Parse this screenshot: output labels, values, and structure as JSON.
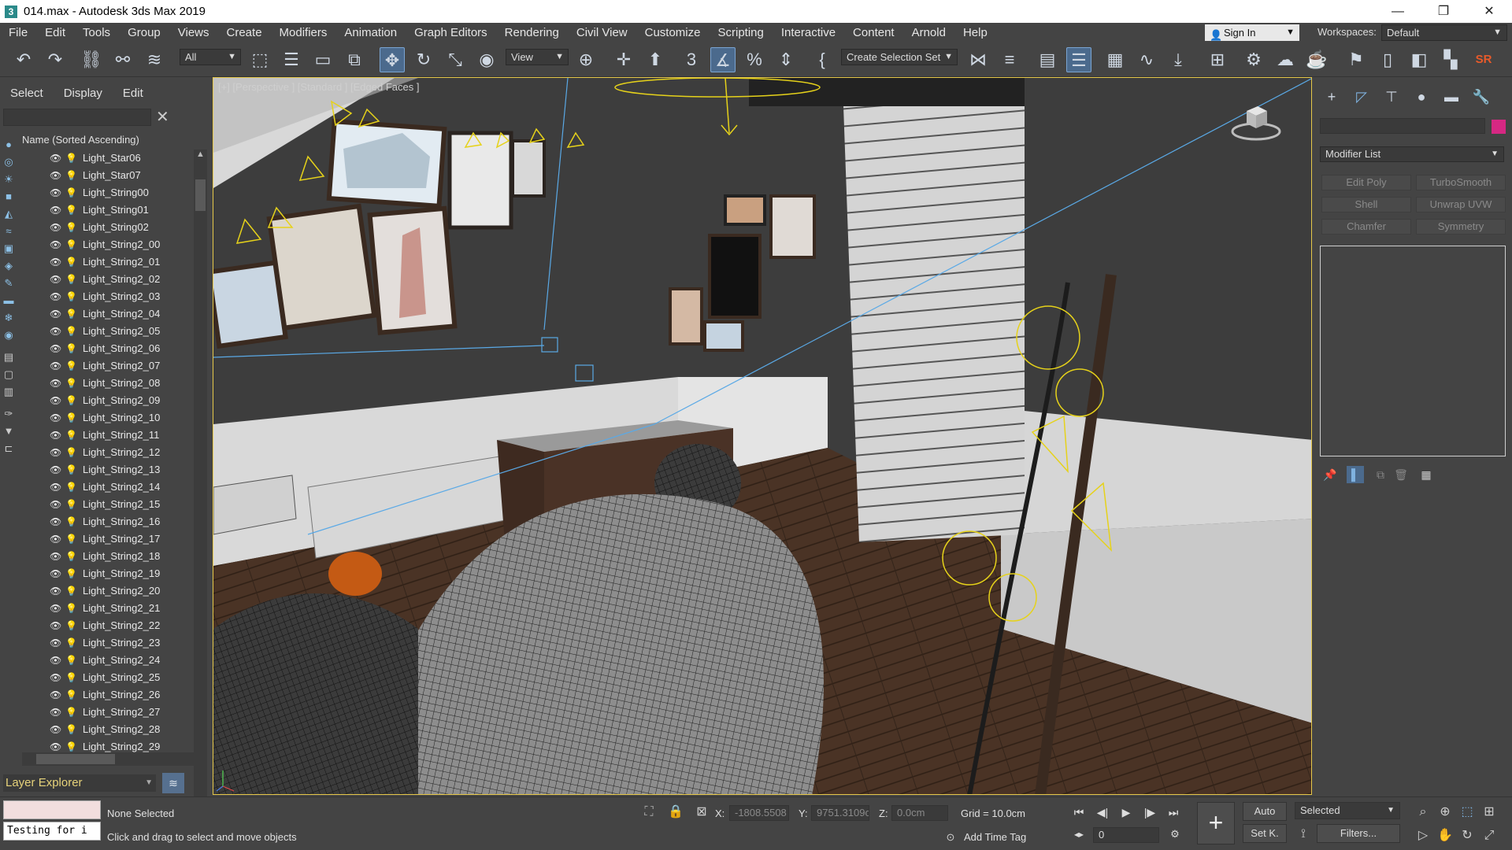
{
  "window": {
    "title": "014.max - Autodesk 3ds Max 2019",
    "app_icon": "3",
    "minimize": "—",
    "restore": "❐",
    "close": "✕"
  },
  "menu": [
    "File",
    "Edit",
    "Tools",
    "Group",
    "Views",
    "Create",
    "Modifiers",
    "Animation",
    "Graph Editors",
    "Rendering",
    "Civil View",
    "Customize",
    "Scripting",
    "Interactive",
    "Content",
    "Arnold",
    "Help"
  ],
  "signin": {
    "label": "Sign In"
  },
  "workspaces": {
    "label": "Workspaces:",
    "value": "Default"
  },
  "toolbar": {
    "filter_value": "All",
    "refcoord_value": "View",
    "selection_set_placeholder": "Create Selection Set",
    "brand_label": "SR"
  },
  "explorer": {
    "tabs": [
      "Select",
      "Display",
      "Edit"
    ],
    "search_value": "",
    "close_glyph": "✕",
    "column_header": "Name (Sorted Ascending)",
    "rows": [
      "Light_Star06",
      "Light_Star07",
      "Light_String00",
      "Light_String01",
      "Light_String02",
      "Light_String2_00",
      "Light_String2_01",
      "Light_String2_02",
      "Light_String2_03",
      "Light_String2_04",
      "Light_String2_05",
      "Light_String2_06",
      "Light_String2_07",
      "Light_String2_08",
      "Light_String2_09",
      "Light_String2_10",
      "Light_String2_11",
      "Light_String2_12",
      "Light_String2_13",
      "Light_String2_14",
      "Light_String2_15",
      "Light_String2_16",
      "Light_String2_17",
      "Light_String2_18",
      "Light_String2_19",
      "Light_String2_20",
      "Light_String2_21",
      "Light_String2_22",
      "Light_String2_23",
      "Light_String2_24",
      "Light_String2_25",
      "Light_String2_26",
      "Light_String2_27",
      "Light_String2_28",
      "Light_String2_29"
    ],
    "layer_dropdown": "Layer Explorer"
  },
  "viewport": {
    "label": "[+] [Perspective ] [Standard ] [Edged Faces ]"
  },
  "command_panel": {
    "modifier_list": "Modifier List",
    "object_color": "#d62883",
    "buttons": [
      "Edit Poly",
      "TurboSmooth",
      "Shell",
      "Unwrap UVW",
      "Chamfer",
      "Symmetry"
    ]
  },
  "status": {
    "maxscript_input": "Testing for i",
    "selection": "None Selected",
    "prompt": "Click and drag to select and move objects",
    "x_label": "X:",
    "x_value": "-1808.5508",
    "y_label": "Y:",
    "y_value": "9751.3109c",
    "z_label": "Z:",
    "z_value": "0.0cm",
    "grid": "Grid = 10.0cm",
    "add_time_tag": "Add Time Tag",
    "auto_key": "Auto",
    "set_key": "Set K.",
    "key_filter_value": "Selected",
    "filters": "Filters...",
    "frame_value": "0"
  }
}
